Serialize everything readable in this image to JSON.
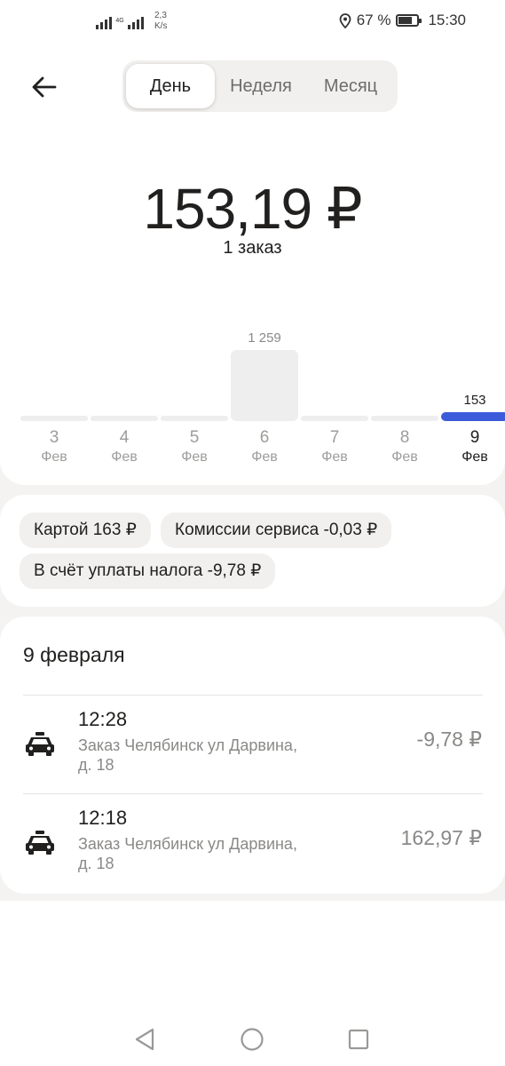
{
  "status_bar": {
    "net_type": "4G",
    "speed_value": "2,3",
    "speed_unit": "K/s",
    "battery": "67 %",
    "time": "15:30"
  },
  "period_tabs": [
    {
      "label": "День",
      "active": true
    },
    {
      "label": "Неделя",
      "active": false
    },
    {
      "label": "Месяц",
      "active": false
    }
  ],
  "summary": {
    "amount": "153,19 ₽",
    "orders": "1 заказ"
  },
  "chart_data": {
    "type": "bar",
    "categories": [
      "3 Фев",
      "4 Фев",
      "5 Фев",
      "6 Фев",
      "7 Фев",
      "8 Фев",
      "9 Фев"
    ],
    "days": [
      "3",
      "4",
      "5",
      "6",
      "7",
      "8",
      "9"
    ],
    "months": [
      "Фев",
      "Фев",
      "Фев",
      "Фев",
      "Фев",
      "Фев",
      "Фев"
    ],
    "values": [
      0,
      0,
      0,
      1259,
      0,
      0,
      153
    ],
    "value_labels": [
      "",
      "",
      "",
      "1 259",
      "",
      "",
      "153"
    ],
    "selected_index": 6,
    "colors": {
      "bar": "#eeeeee",
      "selected": "#3b5bdb"
    }
  },
  "breakdown_chips": [
    {
      "label": "Картой 163 ₽"
    },
    {
      "label": "Комиссии сервиса -0,03 ₽"
    },
    {
      "label": "В счёт уплаты налога -9,78 ₽"
    }
  ],
  "transactions": {
    "date_title": "9 февраля",
    "items": [
      {
        "icon": "taxi-car-icon",
        "time": "12:28",
        "description": "Заказ Челябинск ул Дарвина, д. 18",
        "amount": "-9,78 ₽"
      },
      {
        "icon": "taxi-car-icon",
        "time": "12:18",
        "description": "Заказ Челябинск ул Дарвина, д. 18",
        "amount": "162,97 ₽"
      }
    ]
  },
  "nav_bar": {
    "back": "triangle-back-icon",
    "home": "circle-home-icon",
    "recents": "square-recents-icon"
  }
}
